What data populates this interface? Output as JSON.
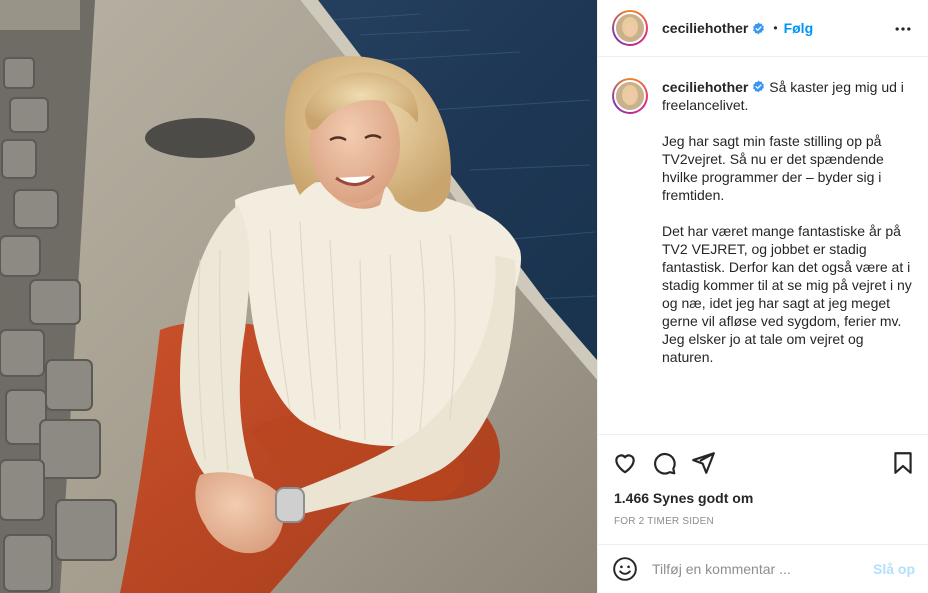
{
  "post": {
    "username": "ceciliehother",
    "verified": true,
    "separator": "•",
    "follow_label": "Følg",
    "caption_paragraphs": [
      "Så kaster jeg mig ud i freelancelivet.",
      "Jeg har sagt min faste stilling op på TV2vejret. Så nu er det spændende hvilke programmer der – byder sig i fremtiden.",
      "Det har været mange fantastiske år på TV2 VEJRET, og jobbet er stadig fantastisk. Derfor kan det også være at i stadig kommer til at se mig på vejret i ny og næ, idet jeg har sagt at jeg meget gerne vil afløse ved sygdom, ferier mv. Jeg elsker jo at tale om vejret og naturen."
    ],
    "likes": "1.466 Synes godt om",
    "time": "FOR 2 TIMER SIDEN"
  },
  "comment": {
    "placeholder": "Tilføj en kommentar ...",
    "post_label": "Slå op"
  },
  "icons": {
    "more": "more-options-icon",
    "like": "heart-icon",
    "comment": "comment-icon",
    "share": "paper-plane-icon",
    "save": "bookmark-icon",
    "emoji": "emoji-icon",
    "verified": "verified-badge-icon"
  },
  "colors": {
    "accent": "#0095f6",
    "verified": "#3897f0",
    "post_disabled": "#b2dffc"
  }
}
